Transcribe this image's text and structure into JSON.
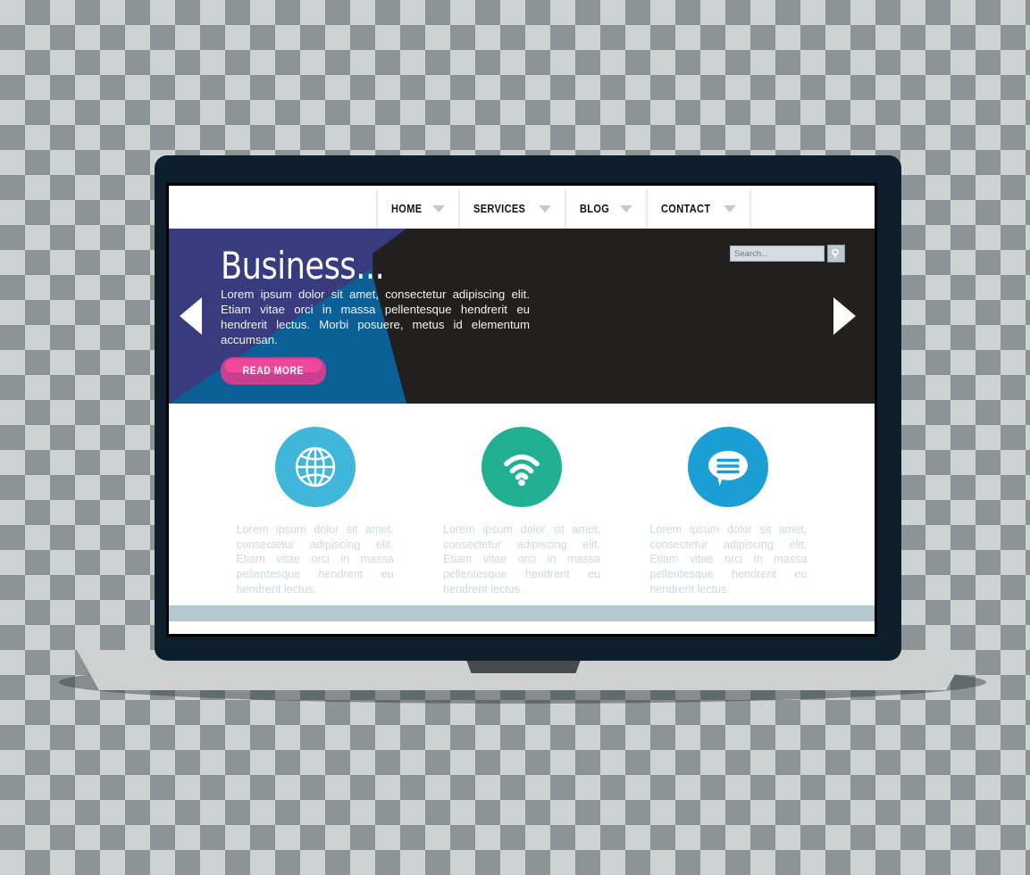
{
  "page": {
    "title": "Responsive Web Design Laptop Mockup"
  },
  "nav": {
    "items": [
      {
        "label": "HOME",
        "icon": "chevron-down-icon"
      },
      {
        "label": "SERVICES",
        "icon": "chevron-down-icon"
      },
      {
        "label": "BLOG",
        "icon": "chevron-down-icon"
      },
      {
        "label": "CONTACT",
        "icon": "chevron-down-icon"
      }
    ]
  },
  "search": {
    "value": "",
    "placeholder": "Search...",
    "button_icon": "magnifier-icon"
  },
  "hero": {
    "title": "Business...",
    "paragraph": "Lorem ipsum dolor sit amet, consectetur adipiscing elit. Etiam vitae orci in massa pellentesque hendrerit eu hendrerit lectus. Morbi posuere, metus id elementum accumsan.",
    "cta_label": "READ MORE",
    "prev_icon": "arrow-left-icon",
    "next_icon": "arrow-right-icon",
    "colors": {
      "background": "#221f1f",
      "indigo_panel": "#383b7d",
      "blue_triangle": "#0c6098",
      "cta_base": "#c9408e",
      "cta_highlight": "#f0489a"
    }
  },
  "features": {
    "columns": [
      {
        "icon": "globe-icon",
        "circle_color": "#41b6db",
        "text": "Lorem ipsum dolor sit amet, consectetur adipiscing elit. Etiam vitae orci in massa pellentesque hendrerit eu hendrerit lectus."
      },
      {
        "icon": "wifi-icon",
        "circle_color": "#22b093",
        "text": "Lorem ipsum dolor sit amet, consectetur adipiscing elit. Etiam vitae orci in massa pellentesque hendrerit eu hendrerit lectus."
      },
      {
        "icon": "chat-bubble-icon",
        "circle_color": "#1a9ed4",
        "text": "Lorem ipsum dolor sit amet, consectetur adipiscing elit. Etiam vitae orci in massa pellentesque hendrerit eu hendrerit lectus."
      }
    ]
  },
  "device": {
    "frame_color": "#0d1f2d",
    "base_color": "#cfd1d1",
    "notch_color": "#444b4c"
  },
  "footer": {
    "bar_color": "#b3c7d0"
  }
}
